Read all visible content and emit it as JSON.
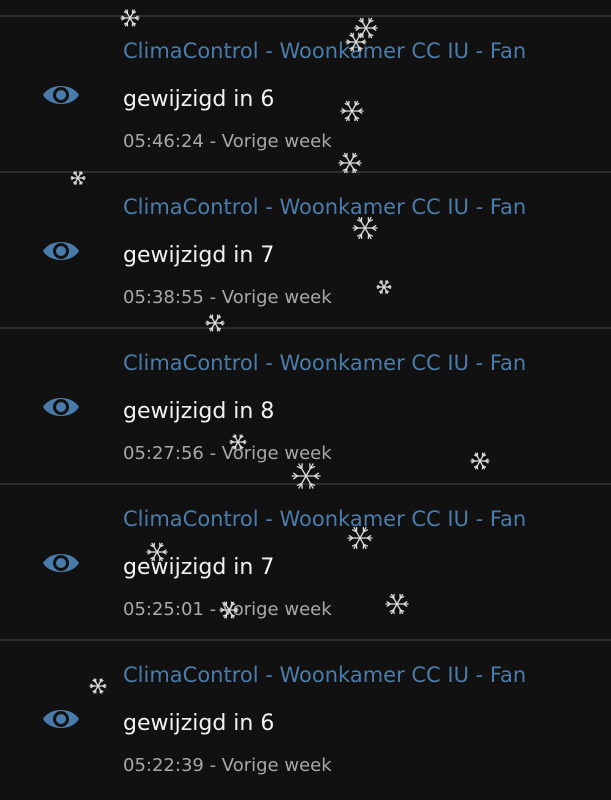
{
  "logbook": {
    "entries": [
      {
        "title": "ClimaControl - Woonkamer CC IU - Fan",
        "message": "gewijzigd in 6",
        "time": "05:46:24",
        "separator": " - ",
        "when": "Vorige week",
        "icon": "eye-icon"
      },
      {
        "title": "ClimaControl - Woonkamer CC IU - Fan",
        "message": "gewijzigd in 7",
        "time": "05:38:55",
        "separator": " - ",
        "when": "Vorige week",
        "icon": "eye-icon"
      },
      {
        "title": "ClimaControl - Woonkamer CC IU - Fan",
        "message": "gewijzigd in 8",
        "time": "05:27:56",
        "separator": " - ",
        "when": "Vorige week",
        "icon": "eye-icon"
      },
      {
        "title": "ClimaControl - Woonkamer CC IU - Fan",
        "message": "gewijzigd in 7",
        "time": "05:25:01",
        "separator": " - ",
        "when": "Vorige week",
        "icon": "eye-icon"
      },
      {
        "title": "ClimaControl - Woonkamer CC IU - Fan",
        "message": "gewijzigd in 6",
        "time": "05:22:39",
        "separator": " - ",
        "when": "Vorige week",
        "icon": "eye-icon"
      }
    ]
  },
  "colors": {
    "background": "#111111",
    "title": "#4a7cab",
    "icon": "#4a7cab",
    "message": "#f2f2f2",
    "time": "#a8a8a8",
    "divider": "#2e2e2e",
    "snowflake": "#dddddd"
  },
  "decoration": {
    "overlay_icon": "snowflake-icon"
  }
}
